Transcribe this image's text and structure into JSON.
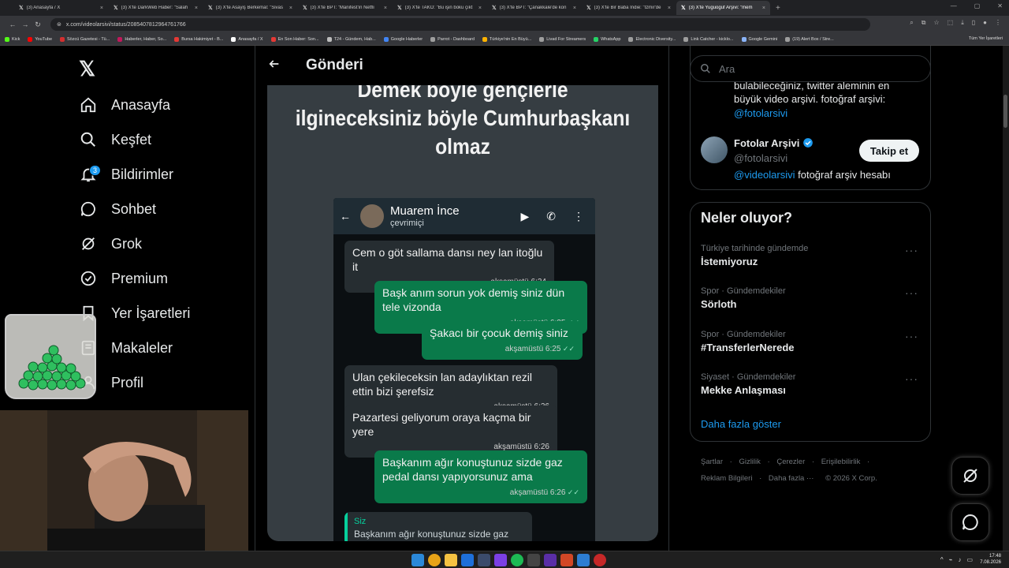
{
  "browser": {
    "tabs": [
      {
        "title": "(3) Anasayfa / X"
      },
      {
        "title": "(3) X'te DarkWeb Haber: \"Salah"
      },
      {
        "title": "(3) X'te Asayiş Berkemal: \"Sivas"
      },
      {
        "title": "(3) X'te BPT: \"Manifest'in Netfli"
      },
      {
        "title": "(3) X'te TAKO: \"Bu işin boku çıkt"
      },
      {
        "title": "(3) X'te BPT: \"Çanakkale'de kon"
      },
      {
        "title": "(3) X'te Bir Baba İndie: \"İzmir'de"
      },
      {
        "title": "(3) X'te Yuguoguf Arşivi: \"mem"
      }
    ],
    "url": "x.com/videolarsivi/status/2085407812964761766",
    "bookmarks": [
      {
        "label": "Kick",
        "color": "#53fc18"
      },
      {
        "label": "YouTube",
        "color": "#ff0000"
      },
      {
        "label": "Sözcü Gazetesi - Tü...",
        "color": "#d32f2f"
      },
      {
        "label": "Haberler, Haber, So...",
        "color": "#c2185b"
      },
      {
        "label": "Bursa Hakimiyet - B...",
        "color": "#e53935"
      },
      {
        "label": "Anasayfa / X",
        "color": "#ffffff"
      },
      {
        "label": "En Son Haber: Son...",
        "color": "#e53935"
      },
      {
        "label": "T24 - Gündem, Hab...",
        "color": "#bdbdbd"
      },
      {
        "label": "Google Haberler",
        "color": "#4285f4"
      },
      {
        "label": "Parrot - Dashboard",
        "color": "#9e9e9e"
      },
      {
        "label": "Türkiye'nin En Büyü...",
        "color": "#ffb300"
      },
      {
        "label": "Livad For Streamers",
        "color": "#9e9e9e"
      },
      {
        "label": "WhatsApp",
        "color": "#25d366"
      },
      {
        "label": "Electronic Diversity...",
        "color": "#9e9e9e"
      },
      {
        "label": "Link Catcher - kicklo...",
        "color": "#9e9e9e"
      },
      {
        "label": "Google Gemini",
        "color": "#8ab4f8"
      },
      {
        "label": "(19) Alert Box / Stre...",
        "color": "#9e9e9e"
      }
    ],
    "all_bookmarks": "Tüm Yer İşaretleri"
  },
  "nav": {
    "items": [
      {
        "label": "Anasayfa",
        "icon": "home-icon"
      },
      {
        "label": "Keşfet",
        "icon": "search-icon"
      },
      {
        "label": "Bildirimler",
        "icon": "bell-icon"
      },
      {
        "label": "Sohbet",
        "icon": "chat-icon"
      },
      {
        "label": "Grok",
        "icon": "grok-icon"
      },
      {
        "label": "Premium",
        "icon": "verified-icon"
      },
      {
        "label": "Yer İşaretleri",
        "icon": "bookmark-icon"
      },
      {
        "label": "Makaleler",
        "icon": "article-icon"
      },
      {
        "label": "Profil",
        "icon": "profile-icon"
      }
    ],
    "notifications_badge": "3"
  },
  "post": {
    "header_title": "Gönderi",
    "caption_lines": [
      "Demek böyle gençlerle",
      "ilgineceksiniz böyle Cumhurbaşkanı",
      "olmaz"
    ],
    "chat": {
      "contact_name": "Muarem İnce",
      "contact_status": "çevrimiçi",
      "messages": [
        {
          "dir": "in",
          "text": "Cem o göt sallama dansı ney lan itoğlu it",
          "time": "akşamüstü 6:24"
        },
        {
          "dir": "out",
          "text": "Başk anım sorun yok demiş siniz dün tele vizonda",
          "time": "akşamüstü 6:25"
        },
        {
          "dir": "out",
          "text": "Şakacı bir çocuk demiş siniz",
          "time": "akşamüstü 6:25"
        },
        {
          "dir": "in",
          "text": "Ulan çekileceksin lan adaylıktan rezil ettin bizi şerefsiz",
          "time": "akşamüstü 6:26"
        },
        {
          "dir": "in",
          "text": "Pazartesi geliyorum oraya kaçma bir yere",
          "time": "akşamüstü 6:26"
        },
        {
          "dir": "out",
          "text": "Başkanım ağır konuştunuz sizde gaz pedal dansı yapıyorsunuz ama",
          "time": "akşamüstü 6:26"
        }
      ],
      "quoted_sender": "Siz",
      "quoted_text": "Başkanım ağır konuştunuz sizde gaz"
    }
  },
  "sidebar": {
    "search_placeholder": "Ara",
    "profile_card": {
      "bio_line1": "bulabileceğiniz, twitter aleminin en",
      "bio_line2": "büyük video arşivi. fotoğraf arşivi:",
      "bio_link": "@fotolarsivi",
      "related_name": "Fotolar Arşivi",
      "related_handle": "@fotolarsivi",
      "related_bio_link": "@videolarsivi",
      "related_bio_text": " fotoğraf arşiv hesabı",
      "follow_label": "Takip et"
    },
    "trends": {
      "title": "Neler oluyor?",
      "items": [
        {
          "context": "Türkiye tarihinde gündemde",
          "name": "İstemiyoruz"
        },
        {
          "context": "Spor · Gündemdekiler",
          "name": "Sörloth"
        },
        {
          "context": "Spor · Gündemdekiler",
          "name": "#TransferlerNerede"
        },
        {
          "context": "Siyaset · Gündemdekiler",
          "name": "Mekke Anlaşması"
        }
      ],
      "show_more": "Daha fazla göster"
    },
    "footer": {
      "line1": [
        "Şartlar",
        "Gizlilik",
        "Çerezler",
        "Erişilebilirlik"
      ],
      "line2": [
        "Reklam Bilgileri",
        "Daha fazla ···",
        "© 2026 X Corp."
      ]
    }
  },
  "taskbar": {
    "time": "17:48",
    "date": "7.08.2026"
  },
  "colors": {
    "accent": "#1d9bf0",
    "bubble_out": "#0a7a4a",
    "bubble_in": "#262d31"
  }
}
